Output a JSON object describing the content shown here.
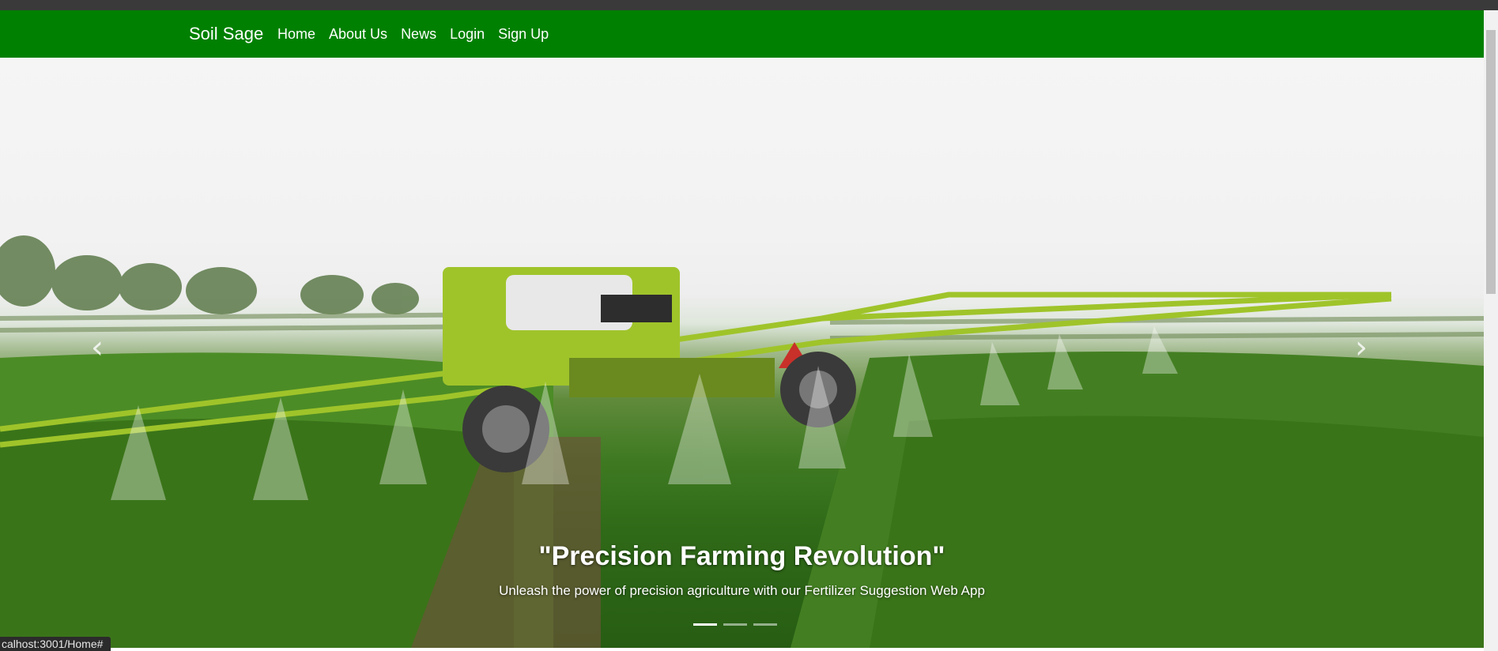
{
  "navbar": {
    "brand": "Soil Sage",
    "links": [
      "Home",
      "About Us",
      "News",
      "Login",
      "Sign Up"
    ],
    "color": "#008000"
  },
  "carousel": {
    "title": "\"Precision Farming Revolution\"",
    "subtitle": "Unleash the power of precision agriculture with our Fertilizer Suggestion Web App",
    "prev_icon": "‹",
    "next_icon": "›",
    "slide_count": 3,
    "active_slide": 1
  },
  "status": {
    "url": "calhost:3001/Home#"
  },
  "icons": {
    "prev": "chevron-left-icon",
    "next": "chevron-right-icon"
  }
}
